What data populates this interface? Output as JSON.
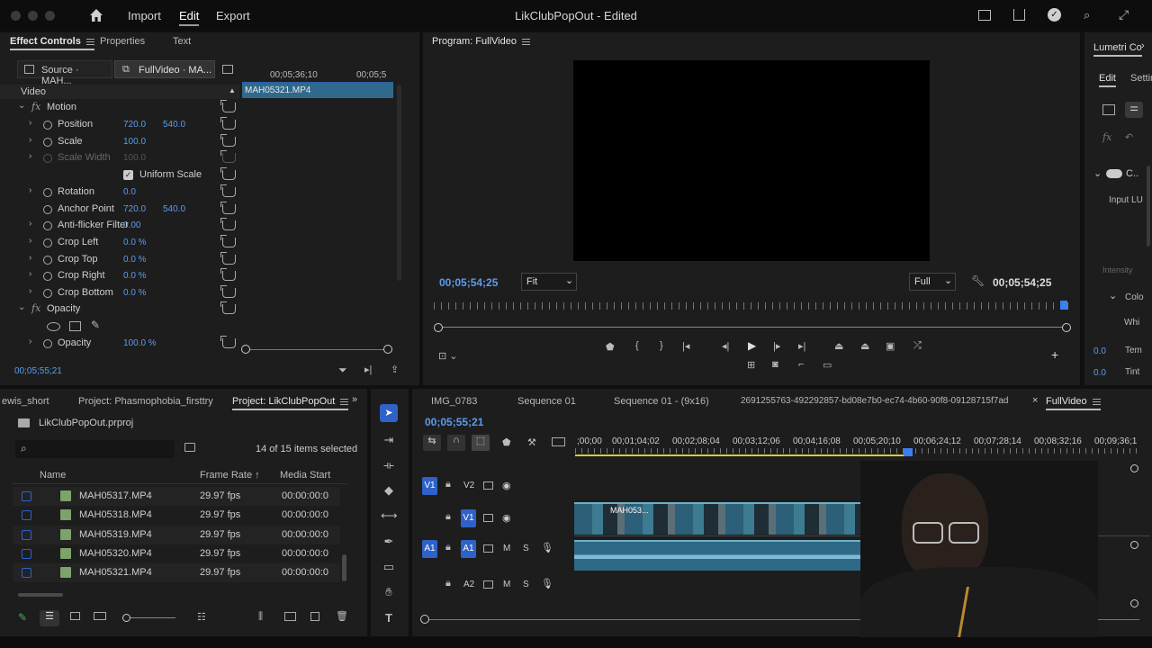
{
  "topbar": {
    "menu": [
      "Import",
      "Edit",
      "Export"
    ],
    "active_menu": "Edit",
    "title": "LikClubPopOut - Edited"
  },
  "effect_controls": {
    "tabs": [
      "Effect Controls",
      "Properties",
      "Text"
    ],
    "source_tab": "Source · MAH...",
    "clip_tab": "FullVideo · MA...",
    "time_ruler": [
      "00;05;36;10",
      "00;05;5"
    ],
    "clip_name": "MAH05321.MP4",
    "section": "Video",
    "motion": "Motion",
    "opacity_group": "Opacity",
    "props": [
      {
        "label": "Position",
        "v1": "720.0",
        "v2": "540.0",
        "tw": true
      },
      {
        "label": "Scale",
        "v1": "100.0",
        "tw": true
      },
      {
        "label": "Scale Width",
        "v1": "100.0",
        "dim": true,
        "tw": true
      },
      {
        "label": "Uniform Scale",
        "checkbox": true
      },
      {
        "label": "Rotation",
        "v1": "0.0",
        "tw": true
      },
      {
        "label": "Anchor Point",
        "v1": "720.0",
        "v2": "540.0"
      },
      {
        "label": "Anti-flicker Filter",
        "v1": "0.00",
        "tw": true
      },
      {
        "label": "Crop Left",
        "v1": "0.0 %",
        "tw": true
      },
      {
        "label": "Crop Top",
        "v1": "0.0 %",
        "tw": true
      },
      {
        "label": "Crop Right",
        "v1": "0.0 %",
        "tw": true
      },
      {
        "label": "Crop Bottom",
        "v1": "0.0 %",
        "tw": true
      }
    ],
    "opacity": {
      "label": "Opacity",
      "v1": "100.0 %"
    },
    "timecode": "00;05;55;21"
  },
  "program": {
    "title": "Program: FullVideo",
    "timecode_left": "00;05;54;25",
    "fit": "Fit",
    "quality": "Full",
    "timecode_right": "00;05;54;25"
  },
  "lumetri": {
    "title": "Lumetri Co",
    "tabs": [
      "Edit",
      "Settin"
    ],
    "items": [
      "Input LU",
      "Intensity",
      "Colo",
      "Whi",
      "Tem",
      "Tint"
    ],
    "values": [
      "0.0",
      "0.0"
    ]
  },
  "project": {
    "tabs": [
      "ewis_short",
      "Project: Phasmophobia_firsttry",
      "Project: LikClubPopOut"
    ],
    "file": "LikClubPopOut.prproj",
    "selection": "14 of 15 items selected",
    "columns": [
      "Name",
      "Frame Rate",
      "Media Start"
    ],
    "rows": [
      {
        "name": "MAH05317.MP4",
        "fps": "29.97 fps",
        "start": "00:00:00:0"
      },
      {
        "name": "MAH05318.MP4",
        "fps": "29.97 fps",
        "start": "00:00:00:0"
      },
      {
        "name": "MAH05319.MP4",
        "fps": "29.97 fps",
        "start": "00:00:00:0"
      },
      {
        "name": "MAH05320.MP4",
        "fps": "29.97 fps",
        "start": "00:00:00:0"
      },
      {
        "name": "MAH05321.MP4",
        "fps": "29.97 fps",
        "start": "00:00:00:0"
      }
    ]
  },
  "timeline": {
    "tabs": [
      "IMG_0783",
      "Sequence 01",
      "Sequence 01 - (9x16)",
      "2691255763-492292857-bd08e7b0-ec74-4b60-90f8-09128715f7ad",
      "FullVideo"
    ],
    "timecode": "00;05;55;21",
    "ruler": [
      ";00;00",
      "00;01;04;02",
      "00;02;08;04",
      "00;03;12;06",
      "00;04;16;08",
      "00;05;20;10",
      "00;06;24;12",
      "00;07;28;14",
      "00;08;32;16",
      "00;09;36;1"
    ],
    "tracks": [
      {
        "src": "V1",
        "name": "V2"
      },
      {
        "name": "V1"
      },
      {
        "src": "A1",
        "name": "A1"
      },
      {
        "name": "A2"
      }
    ],
    "clip_label": "MAH053..."
  }
}
